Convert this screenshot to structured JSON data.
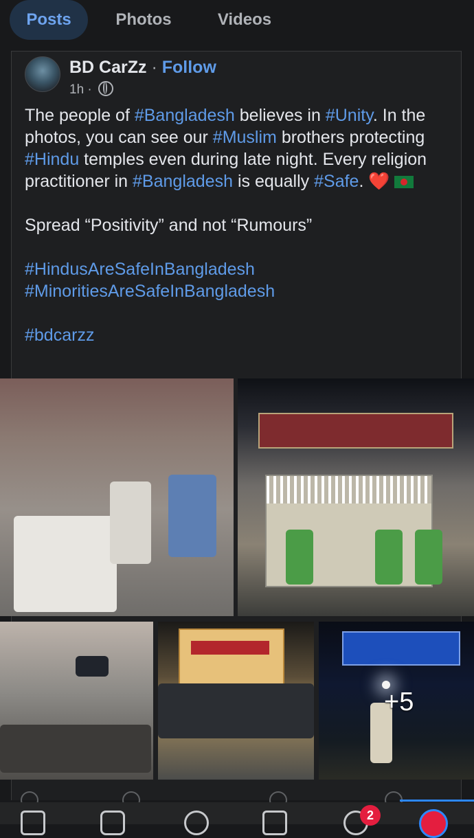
{
  "tabs": [
    {
      "label": "Posts"
    },
    {
      "label": "Photos"
    },
    {
      "label": "Videos"
    }
  ],
  "post": {
    "author": "BD CarZz",
    "separator": " · ",
    "follow_label": "Follow",
    "time": "1h",
    "time_separator": " · ",
    "audience_icon": "globe-icon",
    "paragraph1": {
      "t1": "The people of ",
      "h1": "#Bangladesh",
      "t2": " believes in ",
      "h2": "#Unity",
      "t3": ". In the photos, you can see our ",
      "h3": "#Muslim",
      "t4": " brothers protecting ",
      "h4": "#Hindu",
      "t5": " temples even during late night. Every religion practitioner in ",
      "h5": "#Bangladesh",
      "t6": " is equally ",
      "h6": "#Safe",
      "t7": ". ",
      "heart": "❤️"
    },
    "paragraph2": "Spread “Positivity” and not “Rumours”",
    "hashtags": [
      "#HindusAreSafeInBangladesh",
      "#MinoritiesAreSafeInBangladesh"
    ],
    "final_tag": "#bdcarzz",
    "more_photos_label": "+5"
  },
  "bottom_nav": {
    "notification_count": "2"
  },
  "colors": {
    "accent": "#5f9be8",
    "background": "#18191b",
    "badge": "#e41e3f"
  }
}
